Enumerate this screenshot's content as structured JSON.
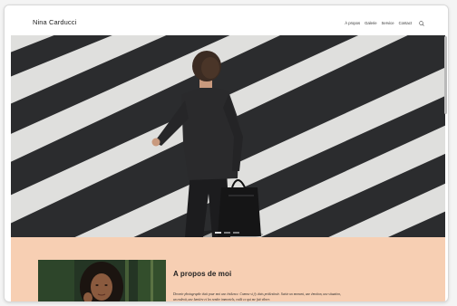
{
  "site": {
    "title": "Nina Carducci"
  },
  "nav": {
    "items": [
      {
        "label": "À propos"
      },
      {
        "label": "Galerie"
      },
      {
        "label": "Service"
      },
      {
        "label": "Contact"
      }
    ],
    "search_icon": "search-icon"
  },
  "hero": {
    "slides": 3,
    "active_slide": 0
  },
  "about": {
    "title": "A propos de moi",
    "paragraph_1": "Devenir photographe était pour moi une évidence. Comme si j'y étais prédestinée. Saisir un moment, une émotion, une situation,",
    "paragraph_2": "un endroit, une lumière et les rendre immortels, voilà ce qui me fait vibrer."
  },
  "colors": {
    "accent": "#f7cfb3",
    "text": "#222222",
    "background": "#ffffff"
  }
}
